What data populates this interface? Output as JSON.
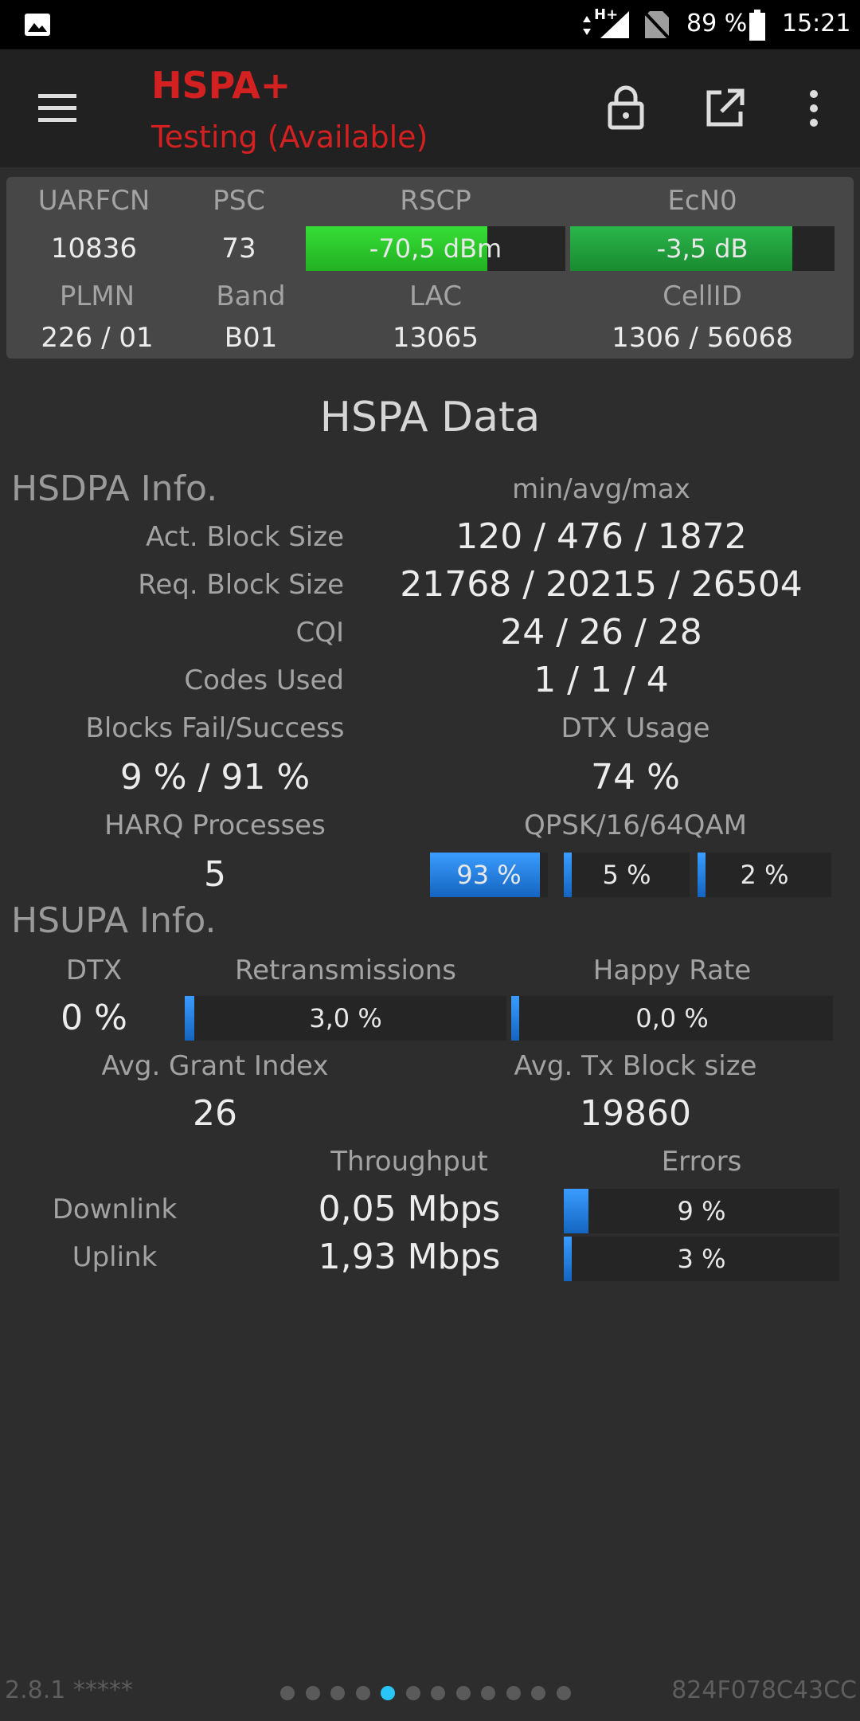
{
  "status_bar": {
    "network": "H+",
    "battery": "89 %",
    "time": "15:21"
  },
  "toolbar": {
    "title": "HSPA+",
    "subtitle": "Testing (Available)"
  },
  "cell": {
    "uarfcn_label": "UARFCN",
    "uarfcn": "10836",
    "psc_label": "PSC",
    "psc": "73",
    "rscp_label": "RSCP",
    "rscp": "-70,5 dBm",
    "rscp_level": 0.7,
    "ecn0_label": "EcN0",
    "ecn0": "-3,5 dB",
    "ecn0_level": 0.84,
    "plmn_label": "PLMN",
    "plmn": "226 / 01",
    "band_label": "Band",
    "band": "B01",
    "lac_label": "LAC",
    "lac": "13065",
    "cellid_label": "CellID",
    "cellid": "1306 / 56068"
  },
  "section_title": "HSPA Data",
  "hsdpa": {
    "title": "HSDPA Info.",
    "minavgmax_label": "min/avg/max",
    "act_block_label": "Act. Block Size",
    "act_block": "120 / 476 / 1872",
    "req_block_label": "Req. Block Size",
    "req_block": "21768 / 20215 / 26504",
    "cqi_label": "CQI",
    "cqi": "24 / 26 / 28",
    "codes_label": "Codes Used",
    "codes": "1 / 1 / 4",
    "blocks_label": "Blocks Fail/Success",
    "blocks": "9 % / 91 %",
    "dtx_label": "DTX Usage",
    "dtx": "74 %",
    "harq_label": "HARQ Processes",
    "harq": "5",
    "qam_label": "QPSK/16/64QAM",
    "qpsk": "93 %",
    "qpsk_level": 0.93,
    "qam16": "5 %",
    "qam16_level": 0.05,
    "qam64": "2 %",
    "qam64_level": 0.02
  },
  "hsupa": {
    "title": "HSUPA Info.",
    "dtx_label": "DTX",
    "dtx": "0 %",
    "retrans_label": "Retransmissions",
    "retrans": "3,0 %",
    "retrans_level": 0.03,
    "happy_label": "Happy Rate",
    "happy": "0,0 %",
    "happy_level": 0.0,
    "grant_label": "Avg. Grant Index",
    "grant": "26",
    "txblock_label": "Avg. Tx Block size",
    "txblock": "19860"
  },
  "throughput": {
    "throughput_label": "Throughput",
    "errors_label": "Errors",
    "downlink_label": "Downlink",
    "downlink": "0,05 Mbps",
    "downlink_err": "9 %",
    "downlink_err_level": 0.09,
    "uplink_label": "Uplink",
    "uplink": "1,93 Mbps",
    "uplink_err": "3 %",
    "uplink_err_level": 0.03
  },
  "footer": {
    "version": "2.8.1 *****",
    "device_id": "824F078C43CC",
    "page_count": 12,
    "active_page": 5
  },
  "colors": {
    "title_red": "#d32020",
    "rscp_green": "#2ec92e",
    "ecn0_green": "#23a23a",
    "accent_blue": "#1e88e5",
    "active_dot": "#29c5f6"
  }
}
